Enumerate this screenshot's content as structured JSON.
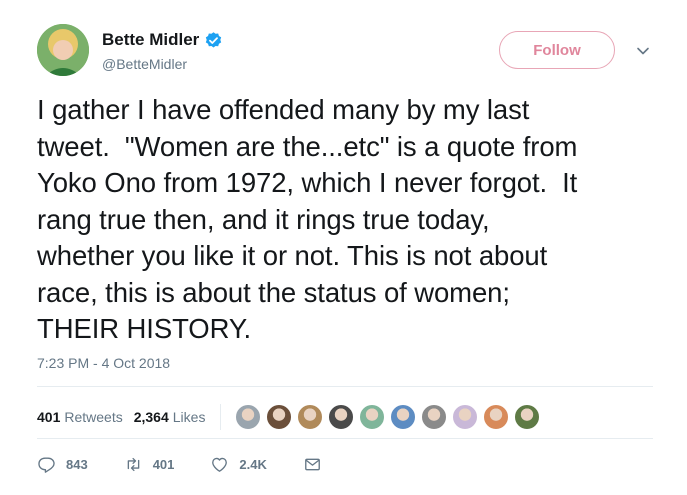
{
  "user": {
    "display_name": "Bette Midler",
    "handle": "@BetteMidler",
    "verified": true,
    "verified_color": "#1da1f2"
  },
  "follow_label": "Follow",
  "follow_color": "#e0869c",
  "tweet_text": "I gather I have offended many by my last\ntweet.  \"Women are the...etc\" is a quote from\nYoko Ono from 1972, which I never forgot.  It\nrang true then, and it rings true today,\nwhether you like it or not. This is not about\nrace, this is about the status of women;\nTHEIR HISTORY.",
  "timestamp": "7:23 PM - 4 Oct 2018",
  "stats": {
    "retweets_count": "401",
    "retweets_label": "Retweets",
    "likes_count": "2,364",
    "likes_label": "Likes"
  },
  "likers": [
    {
      "color": "#9aa5ae"
    },
    {
      "color": "#6b4f3a"
    },
    {
      "color": "#b08a5a"
    },
    {
      "color": "#4a4a4a"
    },
    {
      "color": "#7fb59a"
    },
    {
      "color": "#5d8cc2"
    },
    {
      "color": "#8a8a8a"
    },
    {
      "color": "#c9b8d8"
    },
    {
      "color": "#d88a5a"
    },
    {
      "color": "#5e7a45"
    }
  ],
  "actions": {
    "reply_count": "843",
    "retweet_count": "401",
    "like_count": "2.4K"
  },
  "icons": {
    "reply": "reply-icon",
    "retweet": "retweet-icon",
    "like": "heart-icon",
    "message": "envelope-icon",
    "caret": "chevron-down-icon"
  }
}
